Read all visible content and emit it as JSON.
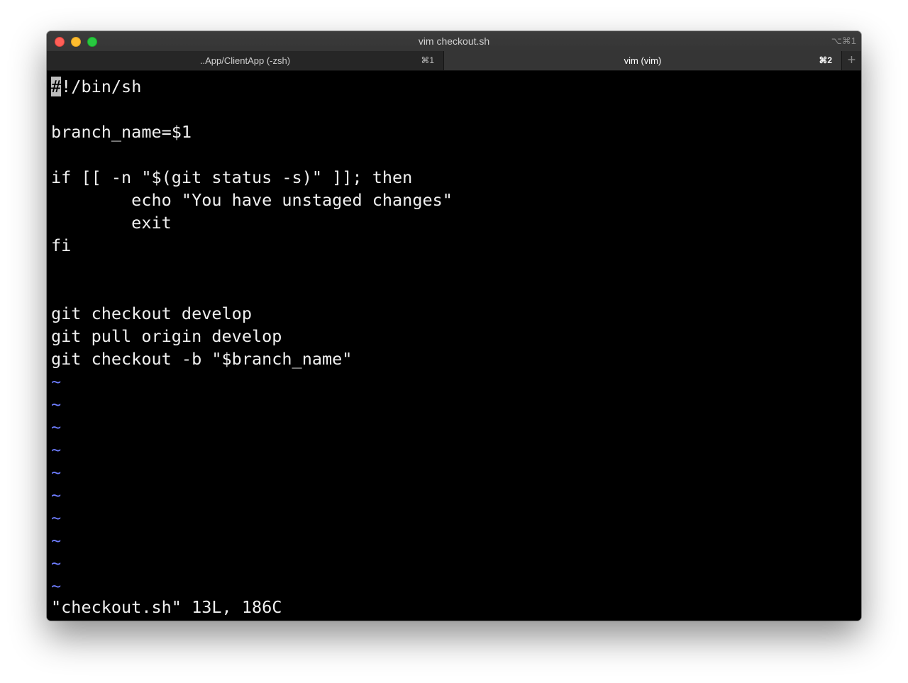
{
  "window": {
    "title": "vim checkout.sh",
    "title_shortcut": "⌥⌘1"
  },
  "tabs": [
    {
      "label": "..App/ClientApp (-zsh)",
      "shortcut": "⌘1",
      "active": false
    },
    {
      "label": "vim (vim)",
      "shortcut": "⌘2",
      "active": true
    }
  ],
  "new_tab_label": "+",
  "editor": {
    "cursor_char": "#",
    "lines": [
      "!/bin/sh",
      "",
      "branch_name=$1",
      "",
      "if [[ -n \"$(git status -s)\" ]]; then",
      "        echo \"You have unstaged changes\"",
      "        exit",
      "fi",
      "",
      "",
      "git checkout develop",
      "git pull origin develop",
      "git checkout -b \"$branch_name\""
    ],
    "tilde": "~",
    "status_line": "\"checkout.sh\" 13L, 186C"
  },
  "colors": {
    "close": "#ff5f57",
    "minimize": "#febc2e",
    "maximize": "#28c840",
    "tilde": "#6e7dff",
    "text": "#f0f0f0",
    "background": "#000000"
  }
}
